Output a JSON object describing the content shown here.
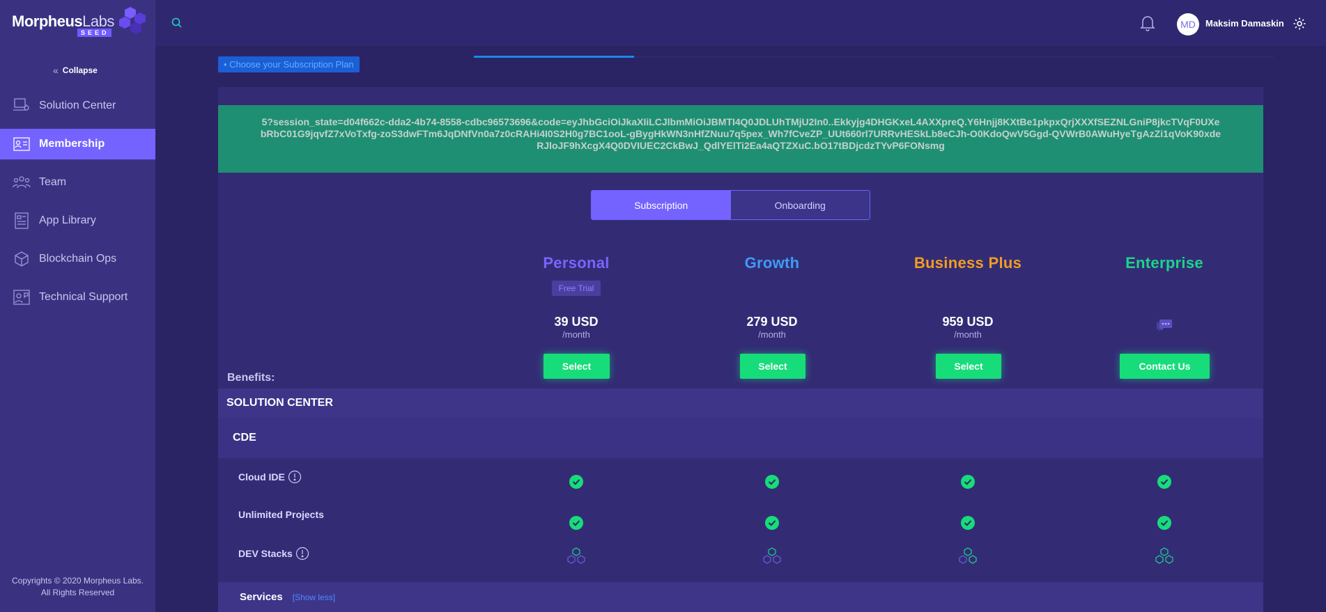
{
  "app": {
    "logo_bold": "Morpheus",
    "logo_light": "Labs",
    "logo_badge": "SEED",
    "collapse_label": "Collapse",
    "copyright_line1": "Copyrights © 2020 Morpheus Labs.",
    "copyright_line2": "All Rights Reserved"
  },
  "sidebar": {
    "items": [
      {
        "label": "Solution Center",
        "icon": "solution-center-icon",
        "active": false
      },
      {
        "label": "Membership",
        "icon": "membership-icon",
        "active": true
      },
      {
        "label": "Team",
        "icon": "team-icon",
        "active": false
      },
      {
        "label": "App Library",
        "icon": "app-library-icon",
        "active": false
      },
      {
        "label": "Blockchain Ops",
        "icon": "blockchain-ops-icon",
        "active": false
      },
      {
        "label": "Technical Support",
        "icon": "technical-support-icon",
        "active": false
      }
    ]
  },
  "header": {
    "user_initials": "MD",
    "user_name": "Maksim Damaskin"
  },
  "wizard": {
    "step_label": "• Choose your Subscription Plan",
    "progress": 0.2
  },
  "banner_text": "5?session_state=d04f662c-dda2-4b74-8558-cdbc96573696&code=eyJhbGciOiJkaXIiLCJlbmMiOiJBMTI4Q0JDLUhTMjU2In0..Ekkyjg4DHGKxeL4AXXpreQ.Y6Hnjj8KXtBe1pkpxQrjXXXfSEZNLGniP8jkcTVqF0UXebRbC01G9jqvfZ7xVoTxfg-zoS3dwFTm6JqDNfVn0a7z0cRAHi4I0S2H0g7BC1ooL-gBygHkWN3nHfZNuu7q5pex_Wh7fCveZP_UUt660rl7URRvHESkLb8eCJh-O0KdoQwV5Ggd-QVWrB0AWuHyeTgAzZi1qVoK90xdeRJloJF9hXcgX4Q0DVIUEC2CkBwJ_QdlYElTi2Ea4aQTZXuC.bO17tBDjcdzTYvP6FONsmg",
  "toggle": {
    "subscription": "Subscription",
    "onboarding": "Onboarding"
  },
  "plans": [
    {
      "name": "Personal",
      "color": "#7b63ff",
      "badge": "Free Trial",
      "price": "39 USD",
      "period": "/month",
      "button": "Select"
    },
    {
      "name": "Growth",
      "color": "#3f9bf5",
      "badge": "",
      "price": "279 USD",
      "period": "/month",
      "button": "Select"
    },
    {
      "name": "Business Plus",
      "color": "#f29c23",
      "badge": "",
      "price": "959 USD",
      "period": "/month",
      "button": "Select"
    },
    {
      "name": "Enterprise",
      "color": "#1cd48a",
      "badge": "",
      "price": "",
      "period": "",
      "button": "Contact Us"
    }
  ],
  "benefits_label": "Benefits:",
  "sections": {
    "solution_center": "SOLUTION CENTER",
    "cde": "CDE",
    "services": "Services",
    "show_less": "[Show less]"
  },
  "features": [
    {
      "label": "Cloud IDE",
      "info": true,
      "type": "check"
    },
    {
      "label": "Unlimited Projects",
      "info": false,
      "type": "check"
    },
    {
      "label": "DEV Stacks",
      "info": true,
      "type": "stacks",
      "stack_levels": [
        1,
        1,
        2,
        3
      ]
    }
  ],
  "colors": {
    "accent": "#7563ff",
    "success": "#17dc7a",
    "banner": "#1f8f73",
    "sidebar": "#3a3281"
  }
}
